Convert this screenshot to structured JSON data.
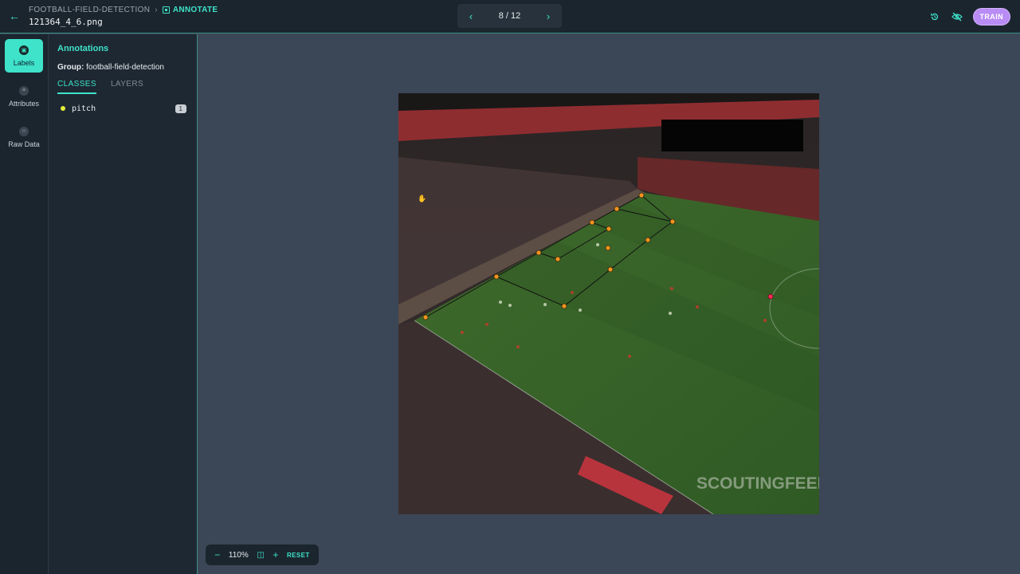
{
  "header": {
    "breadcrumb_project": "FOOTBALL-FIELD-DETECTION",
    "breadcrumb_mode": "ANNOTATE",
    "filename": "121364_4_6.png",
    "pager": "8 / 12",
    "train_label": "TRAIN"
  },
  "rail": {
    "items": [
      {
        "label": "Labels"
      },
      {
        "label": "Attributes"
      },
      {
        "label": "Raw Data"
      }
    ]
  },
  "panel": {
    "title": "Annotations",
    "group_label": "Group:",
    "group_value": "football-field-detection",
    "tabs": [
      "CLASSES",
      "LAYERS"
    ],
    "classes": [
      {
        "name": "pitch",
        "count": "1",
        "color": "#e4ef3a"
      }
    ]
  },
  "image": {
    "watermark": "SCOUTINGFEED"
  },
  "zoom": {
    "value": "110%",
    "reset_label": "RESET"
  },
  "colors": {
    "accent": "#3ee3c9",
    "train": "#b98cf5",
    "keypoint": "#f5941e",
    "keypoint_selected": "#ff2a55"
  }
}
